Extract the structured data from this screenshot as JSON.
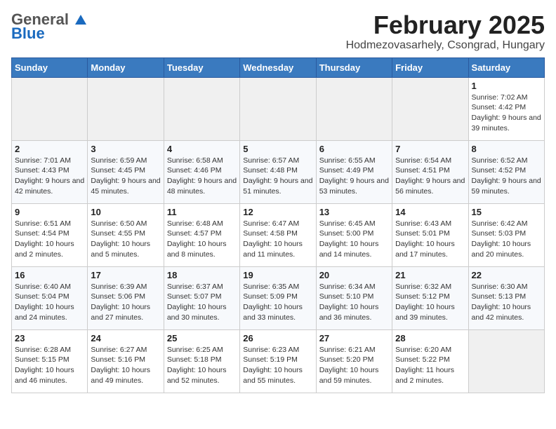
{
  "header": {
    "logo_general": "General",
    "logo_blue": "Blue",
    "title": "February 2025",
    "subtitle": "Hodmezovasarhely, Csongrad, Hungary"
  },
  "calendar": {
    "days_of_week": [
      "Sunday",
      "Monday",
      "Tuesday",
      "Wednesday",
      "Thursday",
      "Friday",
      "Saturday"
    ],
    "weeks": [
      [
        {
          "day": "",
          "info": ""
        },
        {
          "day": "",
          "info": ""
        },
        {
          "day": "",
          "info": ""
        },
        {
          "day": "",
          "info": ""
        },
        {
          "day": "",
          "info": ""
        },
        {
          "day": "",
          "info": ""
        },
        {
          "day": "1",
          "info": "Sunrise: 7:02 AM\nSunset: 4:42 PM\nDaylight: 9 hours and 39 minutes."
        }
      ],
      [
        {
          "day": "2",
          "info": "Sunrise: 7:01 AM\nSunset: 4:43 PM\nDaylight: 9 hours and 42 minutes."
        },
        {
          "day": "3",
          "info": "Sunrise: 6:59 AM\nSunset: 4:45 PM\nDaylight: 9 hours and 45 minutes."
        },
        {
          "day": "4",
          "info": "Sunrise: 6:58 AM\nSunset: 4:46 PM\nDaylight: 9 hours and 48 minutes."
        },
        {
          "day": "5",
          "info": "Sunrise: 6:57 AM\nSunset: 4:48 PM\nDaylight: 9 hours and 51 minutes."
        },
        {
          "day": "6",
          "info": "Sunrise: 6:55 AM\nSunset: 4:49 PM\nDaylight: 9 hours and 53 minutes."
        },
        {
          "day": "7",
          "info": "Sunrise: 6:54 AM\nSunset: 4:51 PM\nDaylight: 9 hours and 56 minutes."
        },
        {
          "day": "8",
          "info": "Sunrise: 6:52 AM\nSunset: 4:52 PM\nDaylight: 9 hours and 59 minutes."
        }
      ],
      [
        {
          "day": "9",
          "info": "Sunrise: 6:51 AM\nSunset: 4:54 PM\nDaylight: 10 hours and 2 minutes."
        },
        {
          "day": "10",
          "info": "Sunrise: 6:50 AM\nSunset: 4:55 PM\nDaylight: 10 hours and 5 minutes."
        },
        {
          "day": "11",
          "info": "Sunrise: 6:48 AM\nSunset: 4:57 PM\nDaylight: 10 hours and 8 minutes."
        },
        {
          "day": "12",
          "info": "Sunrise: 6:47 AM\nSunset: 4:58 PM\nDaylight: 10 hours and 11 minutes."
        },
        {
          "day": "13",
          "info": "Sunrise: 6:45 AM\nSunset: 5:00 PM\nDaylight: 10 hours and 14 minutes."
        },
        {
          "day": "14",
          "info": "Sunrise: 6:43 AM\nSunset: 5:01 PM\nDaylight: 10 hours and 17 minutes."
        },
        {
          "day": "15",
          "info": "Sunrise: 6:42 AM\nSunset: 5:03 PM\nDaylight: 10 hours and 20 minutes."
        }
      ],
      [
        {
          "day": "16",
          "info": "Sunrise: 6:40 AM\nSunset: 5:04 PM\nDaylight: 10 hours and 24 minutes."
        },
        {
          "day": "17",
          "info": "Sunrise: 6:39 AM\nSunset: 5:06 PM\nDaylight: 10 hours and 27 minutes."
        },
        {
          "day": "18",
          "info": "Sunrise: 6:37 AM\nSunset: 5:07 PM\nDaylight: 10 hours and 30 minutes."
        },
        {
          "day": "19",
          "info": "Sunrise: 6:35 AM\nSunset: 5:09 PM\nDaylight: 10 hours and 33 minutes."
        },
        {
          "day": "20",
          "info": "Sunrise: 6:34 AM\nSunset: 5:10 PM\nDaylight: 10 hours and 36 minutes."
        },
        {
          "day": "21",
          "info": "Sunrise: 6:32 AM\nSunset: 5:12 PM\nDaylight: 10 hours and 39 minutes."
        },
        {
          "day": "22",
          "info": "Sunrise: 6:30 AM\nSunset: 5:13 PM\nDaylight: 10 hours and 42 minutes."
        }
      ],
      [
        {
          "day": "23",
          "info": "Sunrise: 6:28 AM\nSunset: 5:15 PM\nDaylight: 10 hours and 46 minutes."
        },
        {
          "day": "24",
          "info": "Sunrise: 6:27 AM\nSunset: 5:16 PM\nDaylight: 10 hours and 49 minutes."
        },
        {
          "day": "25",
          "info": "Sunrise: 6:25 AM\nSunset: 5:18 PM\nDaylight: 10 hours and 52 minutes."
        },
        {
          "day": "26",
          "info": "Sunrise: 6:23 AM\nSunset: 5:19 PM\nDaylight: 10 hours and 55 minutes."
        },
        {
          "day": "27",
          "info": "Sunrise: 6:21 AM\nSunset: 5:20 PM\nDaylight: 10 hours and 59 minutes."
        },
        {
          "day": "28",
          "info": "Sunrise: 6:20 AM\nSunset: 5:22 PM\nDaylight: 11 hours and 2 minutes."
        },
        {
          "day": "",
          "info": ""
        }
      ]
    ]
  }
}
